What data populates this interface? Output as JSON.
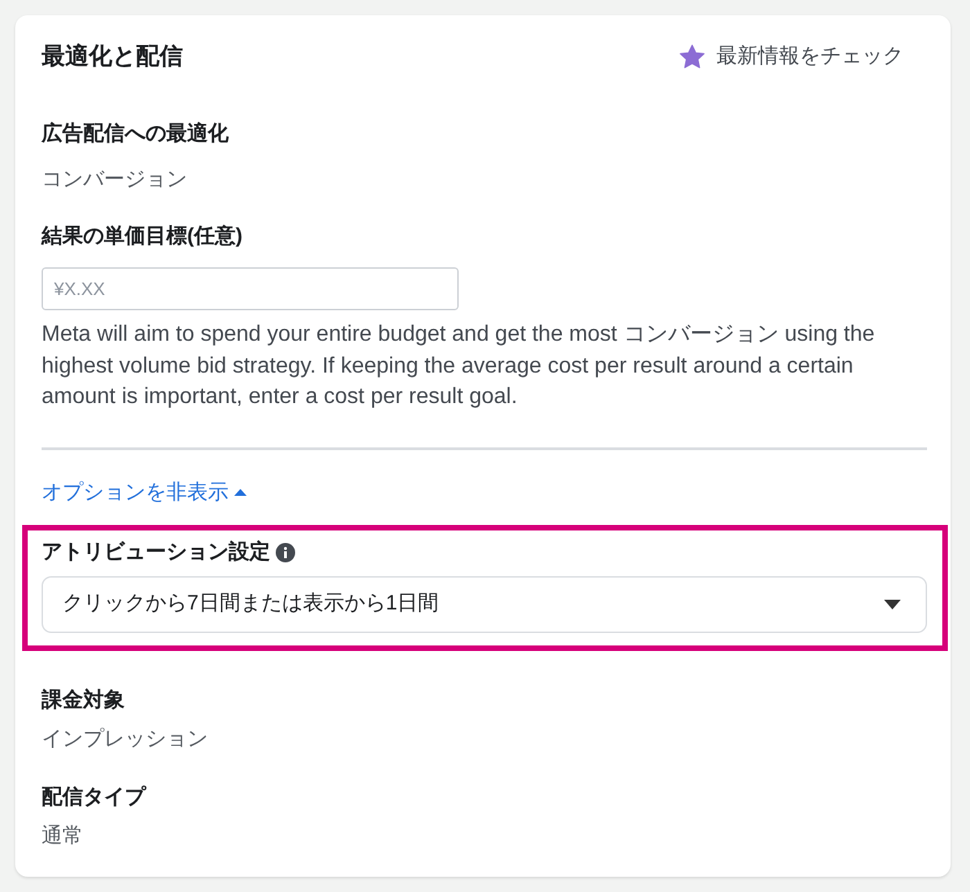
{
  "panel": {
    "title": "最適化と配信",
    "whats_new_link": "最新情報をチェック"
  },
  "fields": [
    {
      "kind": "text",
      "label": "広告配信への最適化",
      "value": "コンバージョン"
    },
    {
      "kind": "input",
      "label": "結果の単価目標(任意)",
      "placeholder": "¥X.XX",
      "help": "Meta will aim to spend your entire budget and get the most コンバージョン using the highest volume bid strategy. If keeping the average cost per result around a certain amount is important, enter a cost per result goal."
    }
  ],
  "options_toggle": {
    "label": "オプションを非表示",
    "expanded": true
  },
  "attribution": {
    "label": "アトリビューション設定",
    "value": "クリックから7日間または表示から1日間",
    "highlighted": true
  },
  "details": [
    {
      "label": "課金対象",
      "value": "インプレッション"
    },
    {
      "label": "配信タイプ",
      "value": "通常"
    }
  ]
}
